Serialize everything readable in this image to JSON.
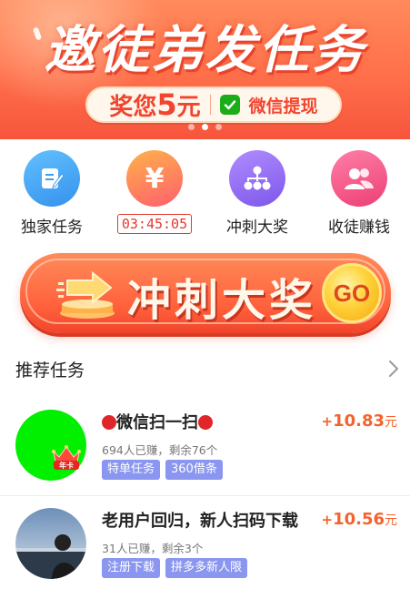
{
  "banner": {
    "title": "邀徒弟发任务",
    "reward_prefix": "奖您",
    "reward_amount": "5",
    "reward_unit": "元",
    "withdraw_label": "微信提现",
    "carousel_active_index": 1,
    "carousel_count": 3
  },
  "shortcuts": [
    {
      "label": "独家任务",
      "icon": "edit-note-icon",
      "color": "#4aa6f2"
    },
    {
      "label": "03:45:05",
      "icon": "yen-icon",
      "color": "#ff8a3d",
      "is_timer": true
    },
    {
      "label": "冲刺大奖",
      "icon": "org-chart-icon",
      "color": "#8f6ff0"
    },
    {
      "label": "收徒赚钱",
      "icon": "users-icon",
      "color": "#f25a8e"
    }
  ],
  "sprint": {
    "text": "冲刺大奖",
    "go_label": "GO"
  },
  "recommended": {
    "title": "推荐任务"
  },
  "tasks": [
    {
      "name_text": "微信扫一扫",
      "meta": "694人已赚，剩余76个",
      "tags": [
        "特单任务",
        "360借条"
      ],
      "reward_sign": "+",
      "reward_amount": "10.83",
      "reward_unit": "元",
      "avatar_color": "#00f000",
      "badge_label": "年卡"
    },
    {
      "name_text": "老用户回归，新人扫码下载",
      "meta": "31人已赚，剩余3个",
      "tags": [
        "注册下载",
        "拼多多新人限"
      ],
      "reward_sign": "+",
      "reward_amount": "10.56",
      "reward_unit": "元"
    }
  ]
}
